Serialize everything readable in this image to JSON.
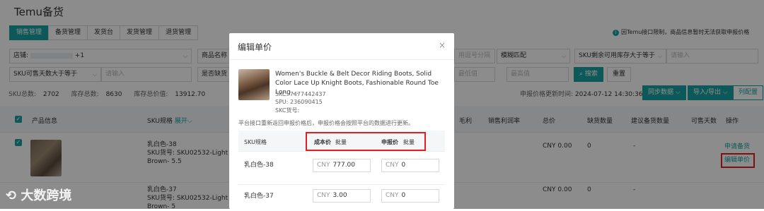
{
  "app_title": "Temu备货",
  "tabs": [
    "销售管理",
    "备货管理",
    "发货台",
    "发货管理",
    "退货管理"
  ],
  "notice": "因Temu接口限制，商品信息暂时无法获取申报价格",
  "filters": {
    "store_label": "店铺:",
    "store_more": "+1",
    "product_name_label": "商品名称",
    "sku_qty_label": "SKU可售天数大于等于",
    "sku_qty_placeholder": "请输入",
    "pending_label": "是否缺货",
    "comma_placeholder": "用逗号分隔",
    "fuzzy_match": "模糊匹配",
    "sku_stock_label": "SKU剩余可用库存大于等于",
    "sku_stock_placeholder": "请输入",
    "min_placeholder": "最低值",
    "max_placeholder": "最高值",
    "search_btn": "搜索",
    "reset_btn": "重置"
  },
  "stats": {
    "sku_total_label": "SKU总数:",
    "sku_total": "2702",
    "stock_total_label": "库存总数:",
    "stock_total": "8630",
    "stock_value_label": "库存总价值:",
    "stock_value": "13912.70",
    "declare_update_label": "申报价格更新时间:",
    "declare_update_time": "2024-07-12 14:30:36",
    "sync_btn": "同步数据",
    "import_btn": "导入/导出",
    "column_btn": "列配置"
  },
  "table": {
    "headers": {
      "product": "产品信息",
      "sku_spec": "SKU规格",
      "expand": "展开",
      "margin": "毛利",
      "sales_margin_rate": "销售利润率",
      "total_price": "总价",
      "shortage_qty": "缺货数量",
      "suggested_qty": "建议备货数量",
      "sellable_days": "可售天数",
      "action": "操作"
    },
    "rows": [
      {
        "sku_color": "乳白色-38",
        "sku_code": "SKU货号: SKU02532-Light Brown- 5.5",
        "total_price": "CNY 0.00",
        "shortage": "0",
        "suggested": "-",
        "action_apply": "申请备货",
        "action_edit": "编辑单价"
      },
      {
        "sku_color": "乳白色-37",
        "sku_code": "SKU货号: SKU02532-Light Brown- 5",
        "total_price": "CNY 0.00",
        "shortage": "0",
        "suggested": "-"
      }
    ]
  },
  "modal": {
    "title": "编辑单价",
    "close": "×",
    "product_title": "Women's Buckle & Belt Decor Riding Boots, Solid Color Lace Up Knight Boots, Fashionable Round Toe Long ...",
    "skc": "SKC: 7477442437",
    "spu": "SPU: 236090415",
    "skc_code": "SKC货号:",
    "hint": "平台接口重新返回申报价格后，申报价格会按照平台的数据进行更新。",
    "col_sku": "SKU规格",
    "col_cost": "成本价",
    "col_declare": "申报价",
    "batch": "批量",
    "currency": "CNY",
    "rows": [
      {
        "sku": "乳白色-38",
        "cost": "777.00",
        "declare": "0"
      },
      {
        "sku": "乳白色-37",
        "cost": "3.00",
        "declare": "0"
      }
    ]
  },
  "watermark": "大数跨境",
  "colors": {
    "accent": "#19a3a3",
    "highlight": "#e02020"
  }
}
